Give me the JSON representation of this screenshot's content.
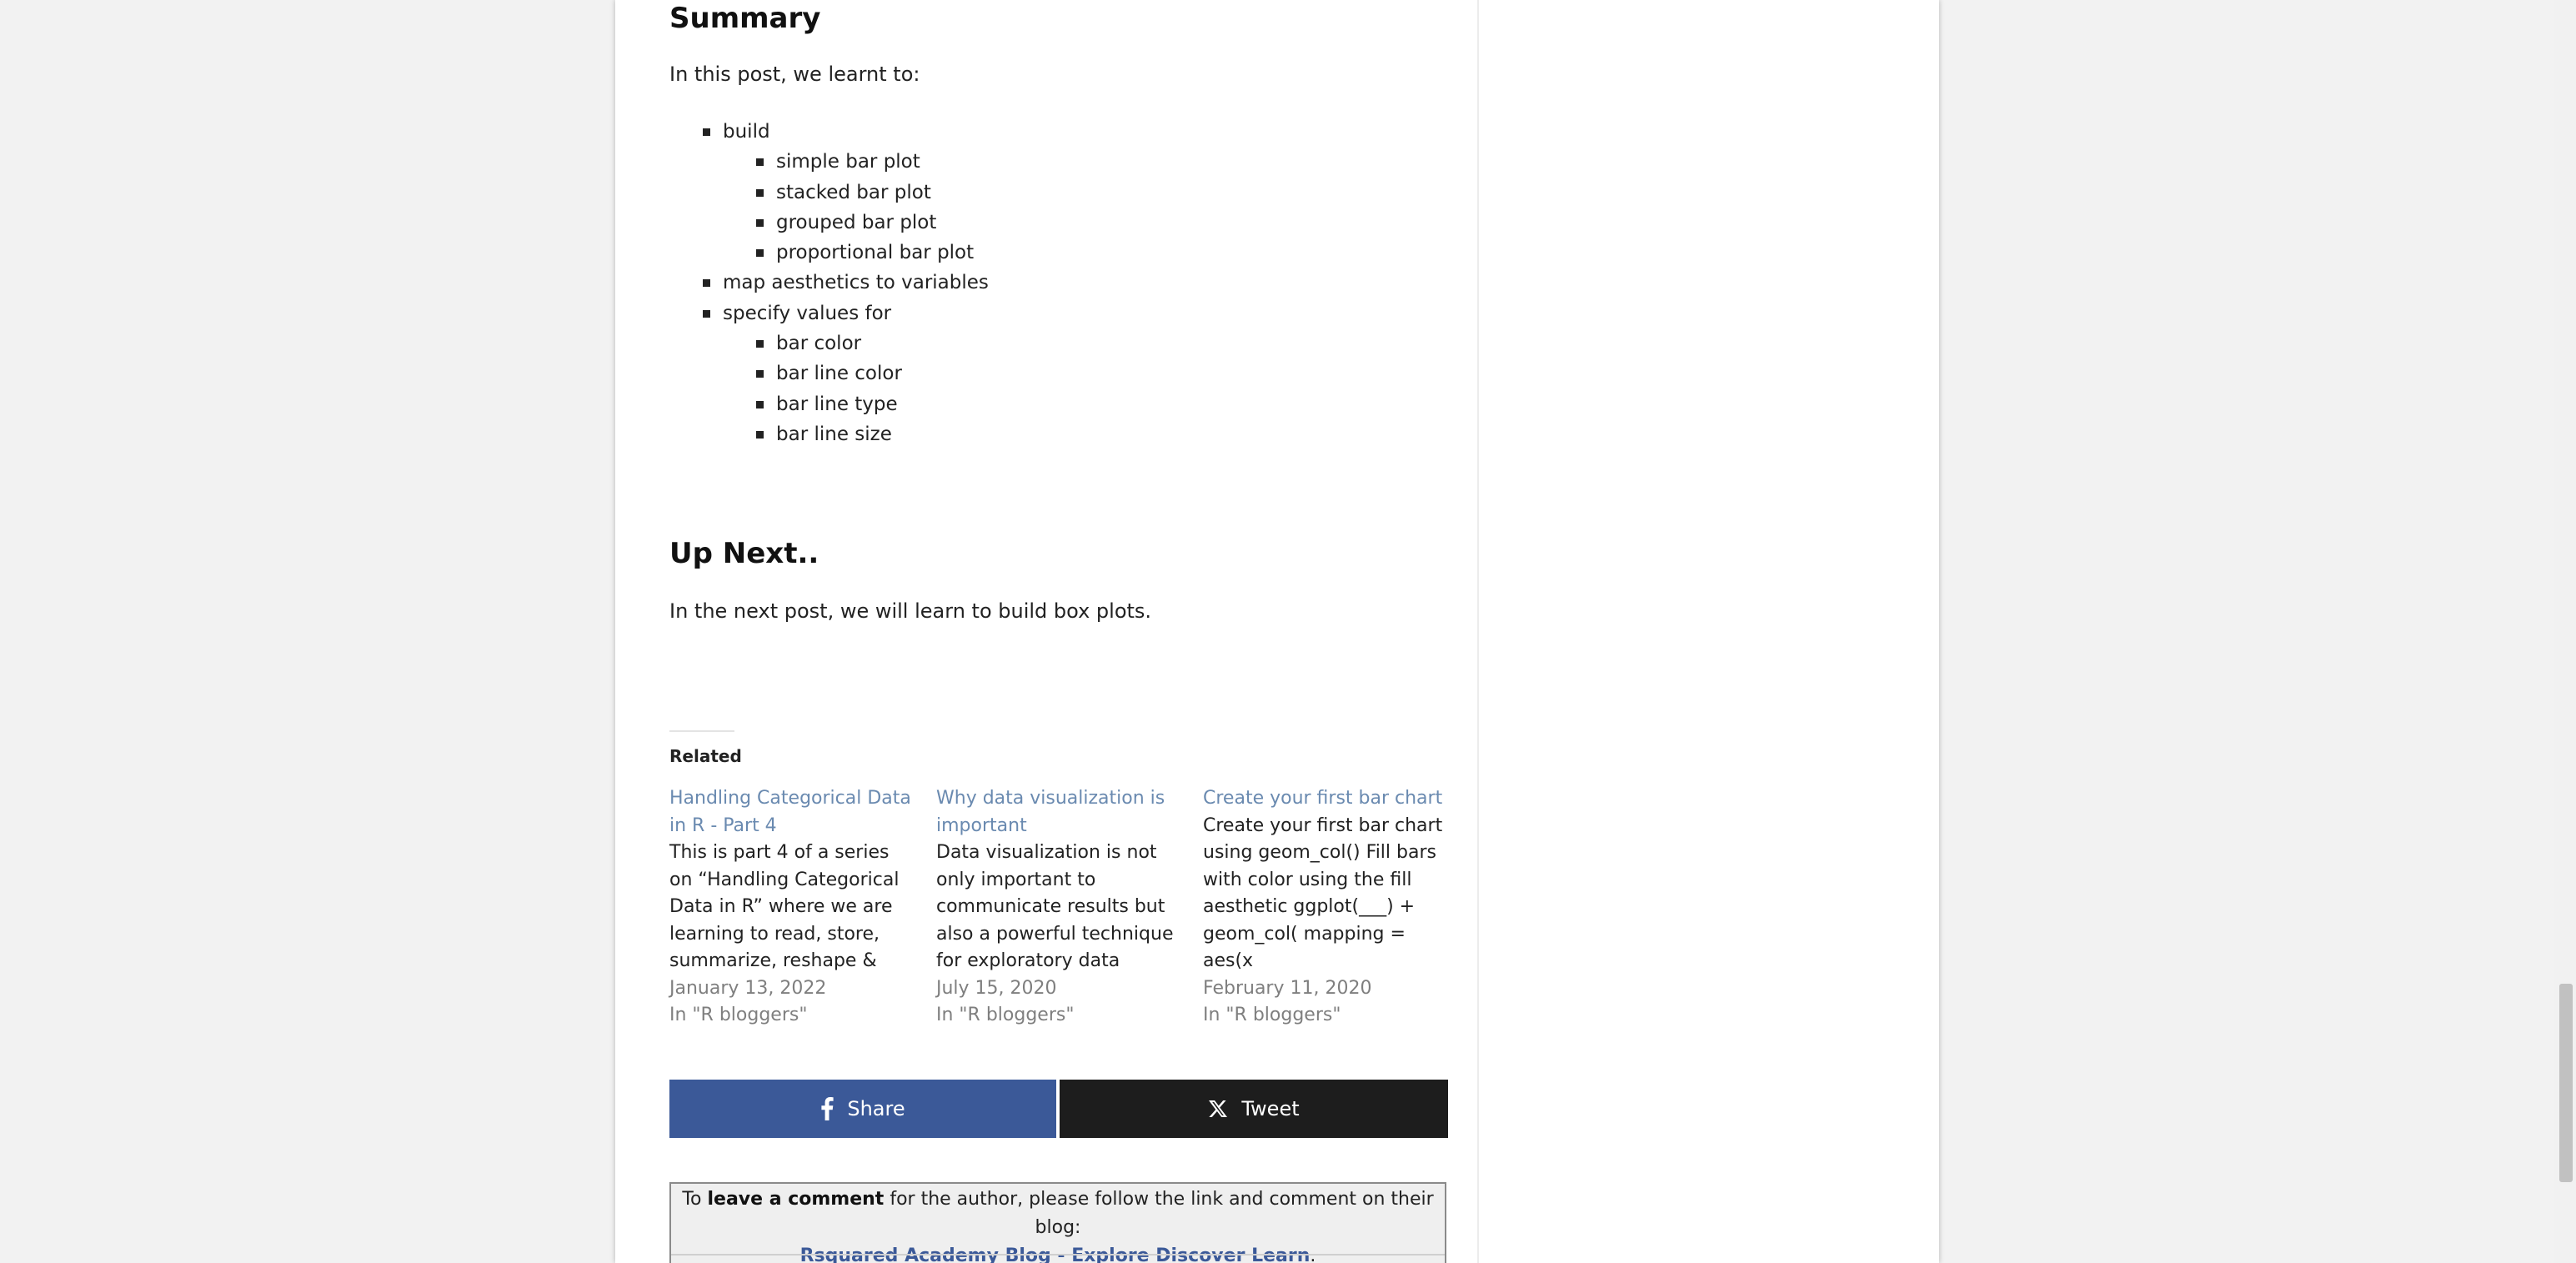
{
  "summary": {
    "heading": "Summary",
    "intro": "In this post, we learnt to:",
    "list": [
      {
        "label": "build",
        "children": [
          "simple bar plot",
          "stacked bar plot",
          "grouped bar plot",
          "proportional bar plot"
        ]
      },
      {
        "label": "map aesthetics to variables",
        "children": []
      },
      {
        "label": "specify values for",
        "children": [
          "bar color",
          "bar line color",
          "bar line type",
          "bar line size"
        ]
      }
    ]
  },
  "upnext": {
    "heading": "Up Next..",
    "text": "In the next post, we will learn to build box plots."
  },
  "related": {
    "label": "Related",
    "items": [
      {
        "title": "Handling Categorical Data in R - Part 4",
        "excerpt": "This is part 4 of a series on “Handling Categorical Data in R” where we are learning to read, store, summarize, reshape &",
        "date": "January 13, 2022",
        "category": "In \"R bloggers\""
      },
      {
        "title": "Why data visualization is important",
        "excerpt": "Data visualization is not only important to communicate results but also a powerful technique for exploratory data",
        "date": "July 15, 2020",
        "category": "In \"R bloggers\""
      },
      {
        "title": "Create your first bar chart",
        "excerpt": "Create your first bar chart using geom_col() Fill bars with color using the fill aesthetic ggplot(___) + geom_col( mapping = aes(x",
        "date": "February 11, 2020",
        "category": "In \"R bloggers\""
      }
    ]
  },
  "share": {
    "share_label": "Share",
    "tweet_label": "Tweet",
    "facebook_color": "#3b5998",
    "x_color": "#1d1d1d"
  },
  "comment": {
    "prefix": "To ",
    "bold": "leave a comment",
    "suffix": " for the author, please follow the link and comment on their blog:",
    "link_text": "Rsquared Academy Blog - Explore Discover Learn",
    "link_end": "."
  }
}
